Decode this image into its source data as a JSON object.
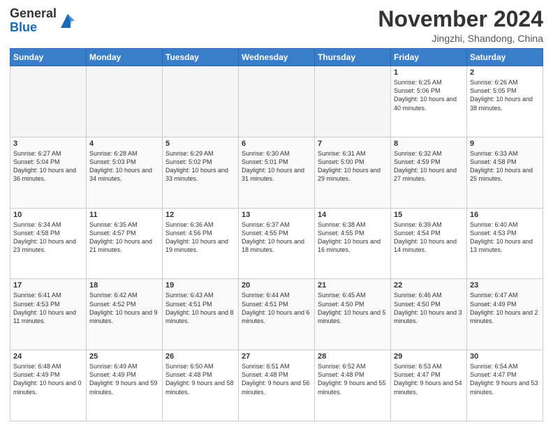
{
  "header": {
    "logo_general": "General",
    "logo_blue": "Blue",
    "month_title": "November 2024",
    "location": "Jingzhi, Shandong, China"
  },
  "weekdays": [
    "Sunday",
    "Monday",
    "Tuesday",
    "Wednesday",
    "Thursday",
    "Friday",
    "Saturday"
  ],
  "weeks": [
    [
      {
        "day": "",
        "empty": true
      },
      {
        "day": "",
        "empty": true
      },
      {
        "day": "",
        "empty": true
      },
      {
        "day": "",
        "empty": true
      },
      {
        "day": "",
        "empty": true
      },
      {
        "day": "1",
        "sunrise": "6:25 AM",
        "sunset": "5:06 PM",
        "daylight": "10 hours and 40 minutes."
      },
      {
        "day": "2",
        "sunrise": "6:26 AM",
        "sunset": "5:05 PM",
        "daylight": "10 hours and 38 minutes."
      }
    ],
    [
      {
        "day": "3",
        "sunrise": "6:27 AM",
        "sunset": "5:04 PM",
        "daylight": "10 hours and 36 minutes."
      },
      {
        "day": "4",
        "sunrise": "6:28 AM",
        "sunset": "5:03 PM",
        "daylight": "10 hours and 34 minutes."
      },
      {
        "day": "5",
        "sunrise": "6:29 AM",
        "sunset": "5:02 PM",
        "daylight": "10 hours and 33 minutes."
      },
      {
        "day": "6",
        "sunrise": "6:30 AM",
        "sunset": "5:01 PM",
        "daylight": "10 hours and 31 minutes."
      },
      {
        "day": "7",
        "sunrise": "6:31 AM",
        "sunset": "5:00 PM",
        "daylight": "10 hours and 29 minutes."
      },
      {
        "day": "8",
        "sunrise": "6:32 AM",
        "sunset": "4:59 PM",
        "daylight": "10 hours and 27 minutes."
      },
      {
        "day": "9",
        "sunrise": "6:33 AM",
        "sunset": "4:58 PM",
        "daylight": "10 hours and 25 minutes."
      }
    ],
    [
      {
        "day": "10",
        "sunrise": "6:34 AM",
        "sunset": "4:58 PM",
        "daylight": "10 hours and 23 minutes."
      },
      {
        "day": "11",
        "sunrise": "6:35 AM",
        "sunset": "4:57 PM",
        "daylight": "10 hours and 21 minutes."
      },
      {
        "day": "12",
        "sunrise": "6:36 AM",
        "sunset": "4:56 PM",
        "daylight": "10 hours and 19 minutes."
      },
      {
        "day": "13",
        "sunrise": "6:37 AM",
        "sunset": "4:55 PM",
        "daylight": "10 hours and 18 minutes."
      },
      {
        "day": "14",
        "sunrise": "6:38 AM",
        "sunset": "4:55 PM",
        "daylight": "10 hours and 16 minutes."
      },
      {
        "day": "15",
        "sunrise": "6:39 AM",
        "sunset": "4:54 PM",
        "daylight": "10 hours and 14 minutes."
      },
      {
        "day": "16",
        "sunrise": "6:40 AM",
        "sunset": "4:53 PM",
        "daylight": "10 hours and 13 minutes."
      }
    ],
    [
      {
        "day": "17",
        "sunrise": "6:41 AM",
        "sunset": "4:53 PM",
        "daylight": "10 hours and 11 minutes."
      },
      {
        "day": "18",
        "sunrise": "6:42 AM",
        "sunset": "4:52 PM",
        "daylight": "10 hours and 9 minutes."
      },
      {
        "day": "19",
        "sunrise": "6:43 AM",
        "sunset": "4:51 PM",
        "daylight": "10 hours and 8 minutes."
      },
      {
        "day": "20",
        "sunrise": "6:44 AM",
        "sunset": "4:51 PM",
        "daylight": "10 hours and 6 minutes."
      },
      {
        "day": "21",
        "sunrise": "6:45 AM",
        "sunset": "4:50 PM",
        "daylight": "10 hours and 5 minutes."
      },
      {
        "day": "22",
        "sunrise": "6:46 AM",
        "sunset": "4:50 PM",
        "daylight": "10 hours and 3 minutes."
      },
      {
        "day": "23",
        "sunrise": "6:47 AM",
        "sunset": "4:49 PM",
        "daylight": "10 hours and 2 minutes."
      }
    ],
    [
      {
        "day": "24",
        "sunrise": "6:48 AM",
        "sunset": "4:49 PM",
        "daylight": "10 hours and 0 minutes."
      },
      {
        "day": "25",
        "sunrise": "6:49 AM",
        "sunset": "4:49 PM",
        "daylight": "9 hours and 59 minutes."
      },
      {
        "day": "26",
        "sunrise": "6:50 AM",
        "sunset": "4:48 PM",
        "daylight": "9 hours and 58 minutes."
      },
      {
        "day": "27",
        "sunrise": "6:51 AM",
        "sunset": "4:48 PM",
        "daylight": "9 hours and 56 minutes."
      },
      {
        "day": "28",
        "sunrise": "6:52 AM",
        "sunset": "4:48 PM",
        "daylight": "9 hours and 55 minutes."
      },
      {
        "day": "29",
        "sunrise": "6:53 AM",
        "sunset": "4:47 PM",
        "daylight": "9 hours and 54 minutes."
      },
      {
        "day": "30",
        "sunrise": "6:54 AM",
        "sunset": "4:47 PM",
        "daylight": "9 hours and 53 minutes."
      }
    ]
  ]
}
